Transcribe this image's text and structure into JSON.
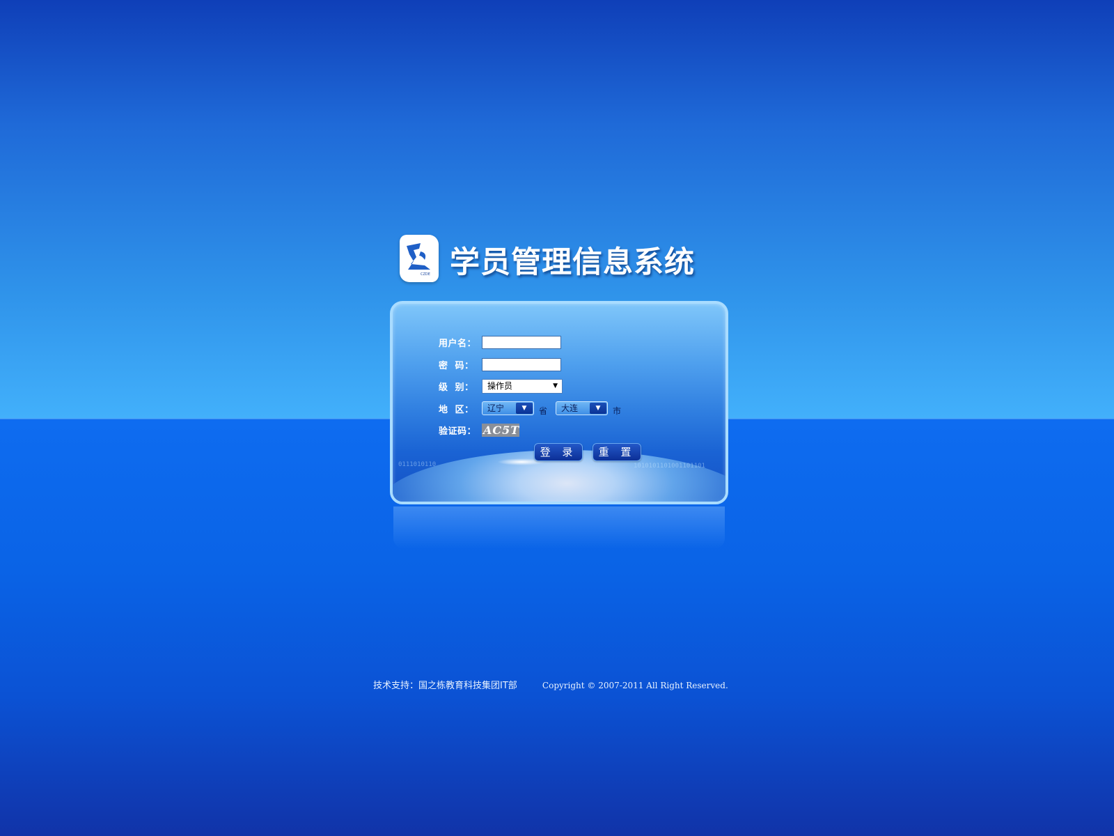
{
  "app": {
    "title": "学员管理信息系统",
    "logo_text": "CZDE"
  },
  "login_form": {
    "username_label": "用户名：",
    "username_value": "",
    "password_label": "密  码：",
    "password_value": "",
    "level_label": "级  别：",
    "level_selected": "操作员",
    "region_label": "地  区：",
    "province_selected": "辽宁",
    "province_unit": "省",
    "city_selected": "大连",
    "city_unit": "市",
    "captcha_label": "验证码：",
    "captcha_value": "AC5T",
    "login_button": "登 录",
    "reset_button": "重 置"
  },
  "footer": {
    "support": "技术支持：国之栋教育科技集团IT部",
    "copyright": "Copyright © 2007-2011 All Right Reserved."
  },
  "colors": {
    "background_top": "#0f3fb8",
    "horizon": "#42b0fb",
    "panel_border": "#a9dcff",
    "button": "#0c2f96"
  }
}
